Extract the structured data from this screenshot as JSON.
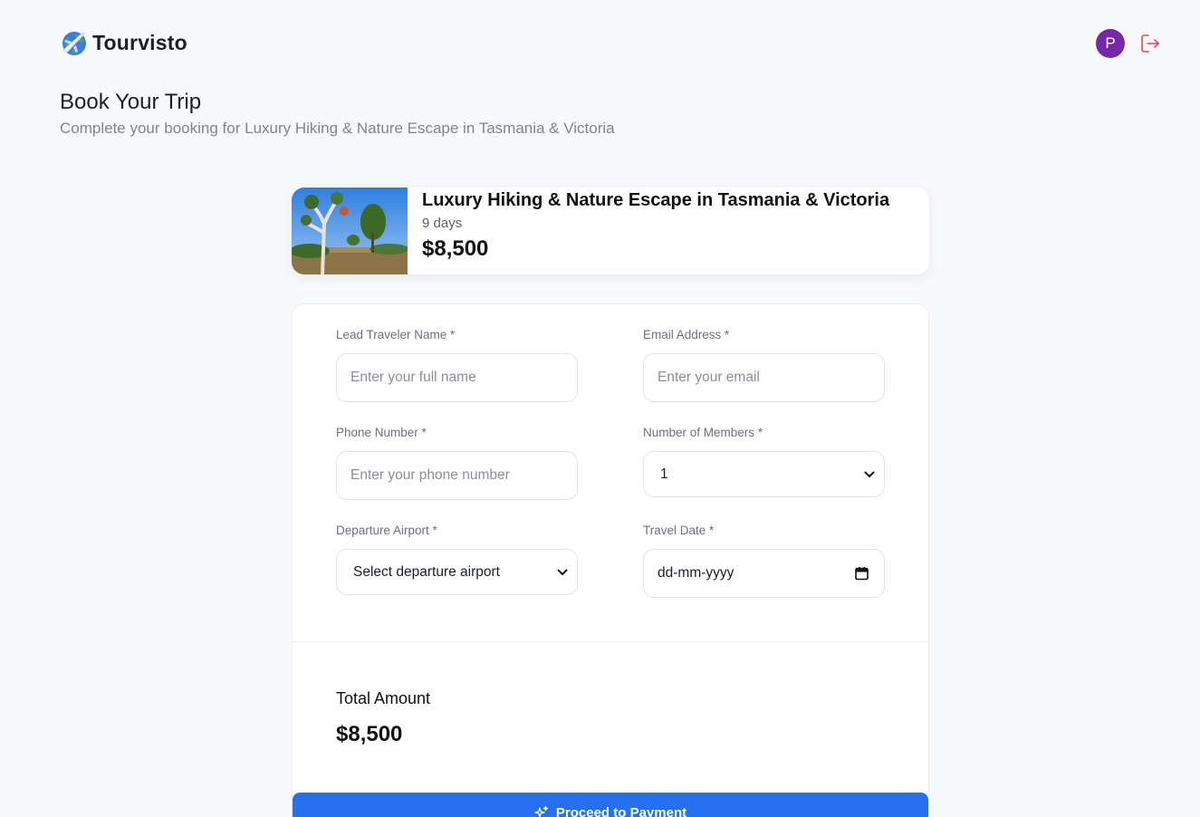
{
  "header": {
    "brand": "Tourvisto",
    "user_name": "Ronald Dale",
    "avatar_initial": "P"
  },
  "page": {
    "title": "Book Your Trip",
    "subtitle": "Complete your booking for Luxury Hiking & Nature Escape in Tasmania & Victoria"
  },
  "trip": {
    "name": "Luxury Hiking & Nature Escape in Tasmania & Victoria",
    "duration": "9 days",
    "price": "$8,500"
  },
  "form": {
    "lead_name": {
      "label": "Lead Traveler Name *",
      "placeholder": "Enter your full name",
      "value": ""
    },
    "email": {
      "label": "Email Address *",
      "placeholder": "Enter your email",
      "value": ""
    },
    "phone": {
      "label": "Phone Number *",
      "placeholder": "Enter your phone number",
      "value": ""
    },
    "members": {
      "label": "Number of Members *",
      "selected": "1"
    },
    "airport": {
      "label": "Departure Airport *",
      "selected": "Select departure airport"
    },
    "travel_date": {
      "label": "Travel Date *",
      "placeholder": "dd-mm-yyyy"
    }
  },
  "summary": {
    "total_label": "Total Amount",
    "total_value": "$8,500"
  },
  "actions": {
    "pay_label": "Proceed to Payment"
  },
  "colors": {
    "accent": "#256ff1",
    "avatar": "#7527a8",
    "logout": "#e34a4a"
  },
  "icons": {
    "logo": "globe-plane-icon",
    "logout": "logout-icon",
    "select": "chevron-down-icon",
    "date": "calendar-icon",
    "button": "sparkle-icon"
  }
}
